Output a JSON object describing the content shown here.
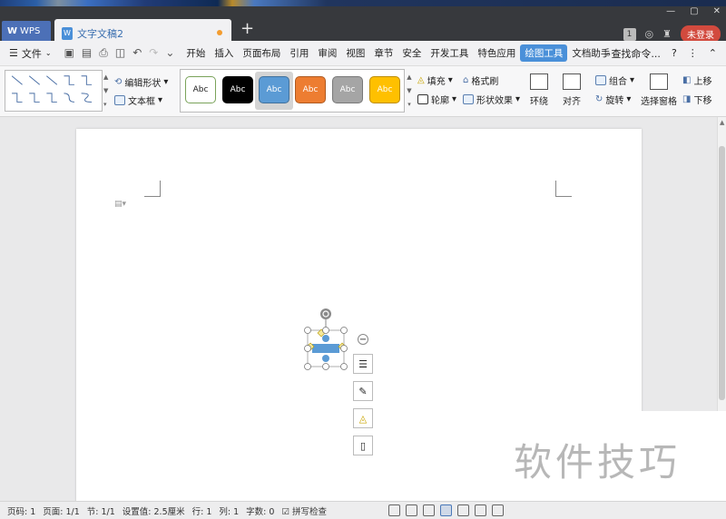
{
  "titlebar": {
    "app_label": "WPS",
    "doc_tab_label": "文字文稿2",
    "new_tab": "+",
    "badge": "1",
    "login_label": "未登录"
  },
  "menubar": {
    "file_label": "文件",
    "items": [
      "开始",
      "插入",
      "页面布局",
      "引用",
      "审阅",
      "视图",
      "章节",
      "安全",
      "开发工具",
      "特色应用",
      "绘图工具",
      "文档助手"
    ],
    "active_item": "绘图工具",
    "search_label": "查找命令...",
    "help": "?"
  },
  "ribbon": {
    "edit_shape": "编辑形状",
    "text_box": "文本框",
    "style_swatches": [
      {
        "label": "Abc",
        "bg": "#ffffff",
        "fg": "#222222",
        "border": "#7aa35a"
      },
      {
        "label": "Abc",
        "bg": "#000000",
        "fg": "#ffffff",
        "border": "#000000"
      },
      {
        "label": "Abc",
        "bg": "#5b9bd5",
        "fg": "#ffffff",
        "border": "#41719c"
      },
      {
        "label": "Abc",
        "bg": "#ed7d31",
        "fg": "#ffffff",
        "border": "#ae5a21"
      },
      {
        "label": "Abc",
        "bg": "#a5a5a5",
        "fg": "#ffffff",
        "border": "#787878"
      },
      {
        "label": "Abc",
        "bg": "#ffc000",
        "fg": "#ffffff",
        "border": "#bc8c00"
      }
    ],
    "fill": "填充",
    "format_painter": "格式刷",
    "outline": "轮廓",
    "shape_effect": "形状效果",
    "wrap": "环绕",
    "align": "对齐",
    "group": "组合",
    "rotate": "旋转",
    "selection_pane": "选择窗格",
    "bring_forward": "上移",
    "send_backward": "下移"
  },
  "watermark": "软件技巧",
  "statusbar": {
    "page_num": "页码: 1",
    "pages": "页面: 1/1",
    "section": "节: 1/1",
    "position": "设置值: 2.5厘米",
    "line": "行: 1",
    "column": "列: 1",
    "word_count": "字数: 0",
    "spell_check": "拼写检查"
  }
}
